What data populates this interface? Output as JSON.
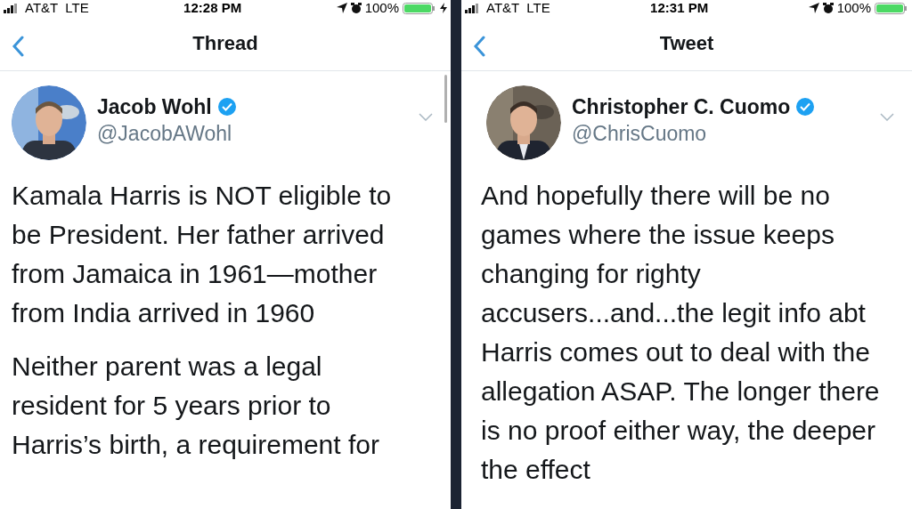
{
  "panels": [
    {
      "status_bar": {
        "carrier": "AT&T",
        "network": "LTE",
        "time": "12:28 PM",
        "battery": "100%"
      },
      "nav_title": "Thread",
      "author": {
        "name": "Jacob Wohl",
        "handle": "@JacobAWohl",
        "verified": true
      },
      "scrollbar": true,
      "paragraphs": [
        "Kamala Harris is NOT eligible to be President. Her father arrived from Jamaica in 1961—mother from India arrived in 1960",
        "Neither parent was a legal resident for 5 years prior to Harris’s birth, a requirement for"
      ]
    },
    {
      "status_bar": {
        "carrier": "AT&T",
        "network": "LTE",
        "time": "12:31 PM",
        "battery": "100%"
      },
      "nav_title": "Tweet",
      "author": {
        "name": "Christopher C. Cuomo",
        "handle": "@ChrisCuomo",
        "verified": true
      },
      "scrollbar": false,
      "paragraphs": [
        "And hopefully there will be no games where the issue keeps changing for righty accusers...and...the legit info abt Harris comes out to deal with the allegation ASAP. The longer there is no proof either way, the deeper the effect"
      ]
    }
  ]
}
